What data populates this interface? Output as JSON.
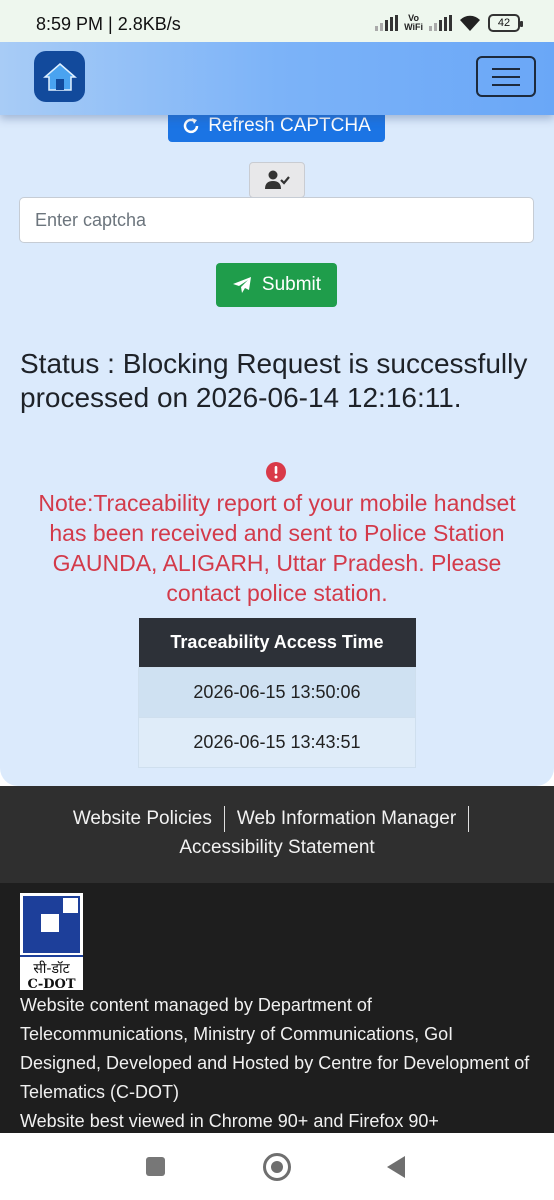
{
  "status_bar": {
    "time_speed": "8:59 PM | 2.8KB/s",
    "vowifi_line1": "Vo",
    "vowifi_line2": "WiFi",
    "battery": "42"
  },
  "navbar": {
    "home_icon": "home-icon",
    "menu_icon": "hamburger-menu-icon",
    "gradient_start": "#a8ccf6",
    "gradient_end": "#6aa7f7"
  },
  "form": {
    "refresh_label": "Refresh CAPTCHA",
    "captcha_placeholder": "Enter captcha",
    "captcha_value": "",
    "submit_label": "Submit"
  },
  "status": {
    "message": "Status : Blocking Request is successfully processed on 2026-06-14 12:16:11."
  },
  "note": {
    "message": "Note:Traceability report of your mobile handset has been received and sent to Police Station GAUNDA, ALIGARH, Uttar Pradesh. Please contact police station."
  },
  "table": {
    "header": "Traceability Access Time",
    "rows": [
      "2026-06-15 13:50:06",
      "2026-06-15 13:43:51"
    ]
  },
  "footer": {
    "links": [
      "Website Policies",
      "Web Information Manager",
      "Accessibility Statement"
    ],
    "logo_hindi": "सी-डॉट",
    "logo_text": "C-DOT",
    "lines": [
      "Website content managed by Department of Telecommunications, Ministry of Communications, GoI",
      "Designed, Developed and Hosted by Centre for Development of Telematics (C-DOT)",
      "Website best viewed in Chrome 90+ and Firefox 90+"
    ]
  },
  "colors": {
    "primary": "#1b74e4",
    "success": "#1f9d4b",
    "danger": "#d33a4a",
    "page_bg": "#dbeafc",
    "footer_dark": "#1e1e1e"
  }
}
